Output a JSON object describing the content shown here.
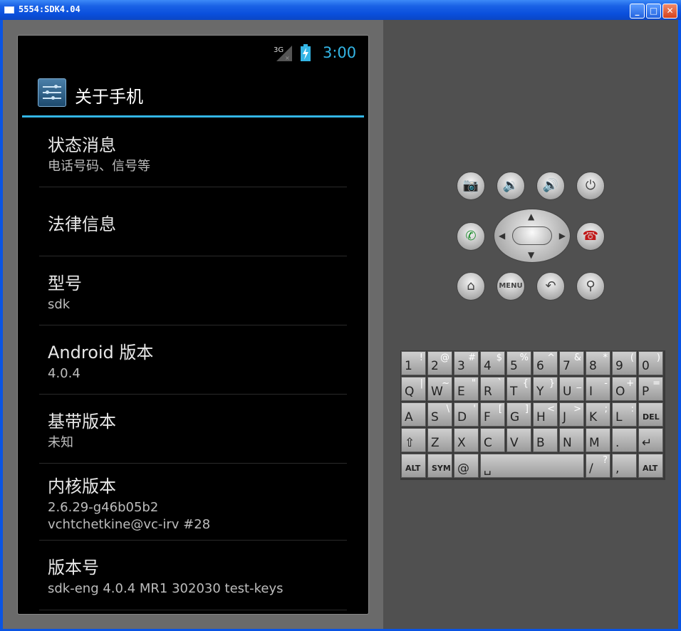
{
  "window": {
    "title": "5554:SDK4.04",
    "minimize": "_",
    "maximize": "□",
    "close": "✕"
  },
  "status": {
    "network": "3G",
    "clock": "3:00"
  },
  "actionbar": {
    "title": "关于手机"
  },
  "items": [
    {
      "title": "状态消息",
      "sub": "电话号码、信号等"
    },
    {
      "title": "法律信息",
      "sub": ""
    },
    {
      "title": "型号",
      "sub": "sdk"
    },
    {
      "title": "Android 版本",
      "sub": "4.0.4"
    },
    {
      "title": "基带版本",
      "sub": "未知"
    },
    {
      "title": "内核版本",
      "sub": "2.6.29-g46b05b2",
      "sub2": "vchtchetkine@vc-irv #28"
    },
    {
      "title": "版本号",
      "sub": "sdk-eng 4.0.4 MR1 302030 test-keys"
    }
  ],
  "controls": {
    "menu_label": "MENU"
  },
  "keyboard": {
    "row1": [
      [
        "1",
        "!"
      ],
      [
        "2",
        "@"
      ],
      [
        "3",
        "#"
      ],
      [
        "4",
        "$"
      ],
      [
        "5",
        "%"
      ],
      [
        "6",
        "^"
      ],
      [
        "7",
        "&"
      ],
      [
        "8",
        "*"
      ],
      [
        "9",
        "("
      ],
      [
        "0",
        ")"
      ]
    ],
    "row2": [
      [
        "Q",
        "|"
      ],
      [
        "W",
        "~"
      ],
      [
        "E",
        "\""
      ],
      [
        "R",
        "`"
      ],
      [
        "T",
        "{"
      ],
      [
        "Y",
        "}"
      ],
      [
        "U",
        "_"
      ],
      [
        "I",
        "-"
      ],
      [
        "O",
        "+"
      ],
      [
        "P",
        "="
      ]
    ],
    "row3": [
      [
        "A",
        ""
      ],
      [
        "S",
        "\\"
      ],
      [
        "D",
        "'"
      ],
      [
        "F",
        "["
      ],
      [
        "G",
        "]"
      ],
      [
        "H",
        "<"
      ],
      [
        "J",
        ">"
      ],
      [
        "K",
        ";"
      ],
      [
        "L",
        ":"
      ],
      [
        "DEL",
        ""
      ]
    ],
    "row4": [
      [
        "⇧",
        ""
      ],
      [
        "Z",
        ""
      ],
      [
        "X",
        ""
      ],
      [
        "C",
        ""
      ],
      [
        "V",
        ""
      ],
      [
        "B",
        ""
      ],
      [
        "N",
        ""
      ],
      [
        "M",
        ""
      ],
      [
        ".",
        ""
      ],
      [
        "↵",
        ""
      ]
    ],
    "row5": {
      "alt_left": "ALT",
      "sym": "SYM",
      "at": "@",
      "space": "␣",
      "slash": "/",
      "slash_alt": "?",
      "comma": ",",
      "alt_right": "ALT"
    }
  },
  "colors": {
    "accent": "#33b5e5",
    "titlebar": "#0a54e3"
  }
}
